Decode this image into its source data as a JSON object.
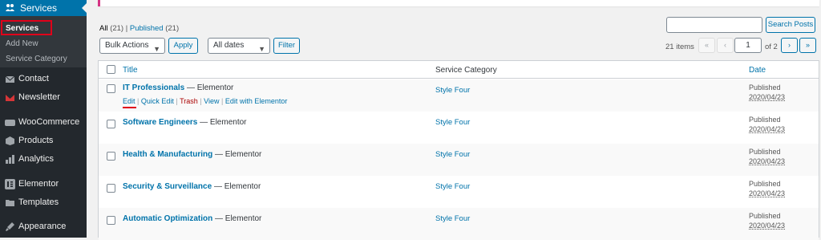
{
  "sidebar": {
    "current": "Services",
    "sub": [
      "Services",
      "Add New",
      "Service Category"
    ],
    "items": [
      "Contact",
      "Newsletter",
      "WooCommerce",
      "Products",
      "Analytics",
      "Elementor",
      "Templates",
      "Appearance"
    ]
  },
  "filters": {
    "all_label": "All",
    "all_count": "(21)",
    "separator": "|",
    "published_label": "Published",
    "published_count": "(21)"
  },
  "search": {
    "placeholder": "",
    "button": "Search Posts"
  },
  "toolbar": {
    "bulk_actions": "Bulk Actions",
    "apply": "Apply",
    "dates": "All dates",
    "filter": "Filter"
  },
  "pagination": {
    "items": "21 items",
    "first": "«",
    "prev": "‹",
    "current_page": "1",
    "of": "of 2",
    "next": "›",
    "last": "»"
  },
  "table": {
    "headers": {
      "title": "Title",
      "category": "Service Category",
      "date": "Date"
    },
    "row_actions": {
      "edit": "Edit",
      "quick_edit": "Quick Edit",
      "trash": "Trash",
      "view": "View",
      "edit_elementor": "Edit with Elementor",
      "separator": "|"
    },
    "rows": [
      {
        "title": "IT Professionals",
        "suffix": "— Elementor",
        "category": "Style Four",
        "status": "Published",
        "date": "2020/04/23"
      },
      {
        "title": "Software Engineers",
        "suffix": "— Elementor",
        "category": "Style Four",
        "status": "Published",
        "date": "2020/04/23"
      },
      {
        "title": "Health & Manufacturing",
        "suffix": "— Elementor",
        "category": "Style Four",
        "status": "Published",
        "date": "2020/04/23"
      },
      {
        "title": "Security & Surveillance",
        "suffix": "— Elementor",
        "category": "Style Four",
        "status": "Published",
        "date": "2020/04/23"
      },
      {
        "title": "Automatic Optimization",
        "suffix": "— Elementor",
        "category": "Style Four",
        "status": "Published",
        "date": "2020/04/23"
      }
    ]
  },
  "colors": {
    "accent": "#0073aa",
    "sidebar": "#23282d",
    "highlight": "#e0001a",
    "trash": "#aa0000"
  }
}
